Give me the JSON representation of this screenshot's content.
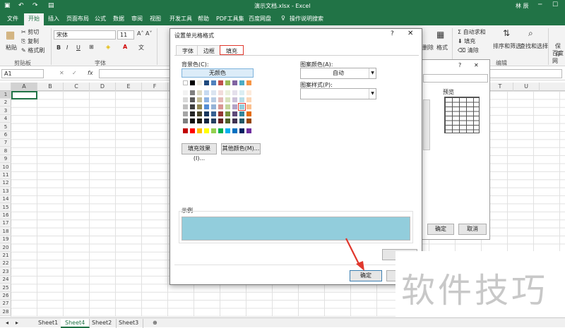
{
  "titlebar": {
    "title": "演示文档.xlsx  -  Excel",
    "user": "林 辰",
    "minimize": "─",
    "restore": "☐"
  },
  "tabs": [
    "文件",
    "开始",
    "插入",
    "页面布局",
    "公式",
    "数据",
    "审阅",
    "视图",
    "开发工具",
    "帮助",
    "PDF工具集",
    "百度网盘"
  ],
  "tell_me": "操作说明搜索",
  "ribbon": {
    "paste": "粘贴",
    "cut": "剪切",
    "copy": "复制",
    "format_painter": "格式刷",
    "clipboard_group": "剪贴板",
    "font_name": "宋体",
    "font_size": "11",
    "bold": "B",
    "italic": "I",
    "underline": "U",
    "font_group": "字体",
    "delete": "删除",
    "format": "格式",
    "autosum": "自动求和",
    "fill": "填充",
    "clear": "清除",
    "sort_filter": "排序和筛选",
    "find_select": "查找和选择",
    "edit_group": "编辑",
    "save": "保存",
    "baidu": "百度网"
  },
  "formula_bar": {
    "name_box": "A1",
    "fx": "fx"
  },
  "columns": [
    "A",
    "B",
    "C",
    "D",
    "E",
    "F",
    "T",
    "U"
  ],
  "rows": [
    "1",
    "2",
    "3",
    "4",
    "5",
    "6",
    "7",
    "8",
    "9",
    "10",
    "11",
    "12",
    "13",
    "14",
    "15",
    "16",
    "17",
    "18",
    "19",
    "20",
    "21",
    "22",
    "23",
    "24",
    "25",
    "26",
    "27",
    "28"
  ],
  "sheets": [
    "Sheet1",
    "Sheet4",
    "Sheet2",
    "Sheet3"
  ],
  "active_sheet": "Sheet4",
  "bg_dialog": {
    "question": "?",
    "preview": "预览",
    "ok": "确定",
    "cancel": "取消"
  },
  "dialog": {
    "title": "设置单元格格式",
    "question": "?",
    "close": "✕",
    "tabs": [
      "字体",
      "边框",
      "填充"
    ],
    "active_tab": "填充",
    "bg_color_label": "背景色(C):",
    "no_color": "无颜色",
    "pattern_color_label": "图案颜色(A):",
    "pattern_color_value": "自动",
    "pattern_style_label": "图案样式(P):",
    "fill_effects": "填充效果(I)...",
    "more_colors": "其他颜色(M)...",
    "sample_label": "示例",
    "clear": "清",
    "ok": "确定",
    "sample_color": "#92cddc",
    "selected_swatch_color": "#92cddc"
  },
  "watermark": "软件技巧",
  "colors": {
    "excel_green": "#217346",
    "annotation_red": "#e0382d"
  }
}
